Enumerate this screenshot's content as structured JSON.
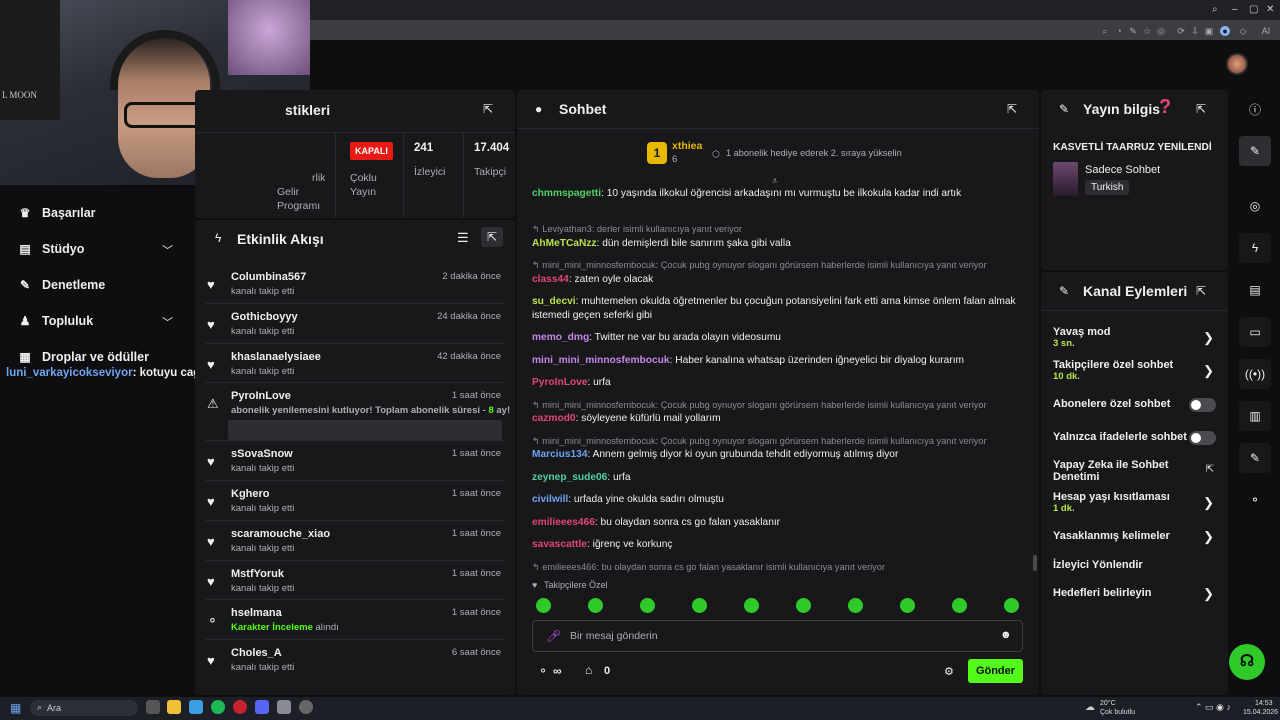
{
  "webcam": {
    "poster_text": "L MOON"
  },
  "left_nav": {
    "items": [
      {
        "label": "Başarılar",
        "icon": "trophy-icon"
      },
      {
        "label": "Stüdyo",
        "icon": "studio-icon"
      },
      {
        "label": "Denetleme",
        "icon": "wrench-icon"
      },
      {
        "label": "Topluluk",
        "icon": "community-icon"
      },
      {
        "label": "Droplar ve ödüller",
        "icon": "gift-icon"
      }
    ]
  },
  "overlay_message": {
    "user": "luni_varkayicokseviyor",
    "text": ": kotuyu cagirma"
  },
  "stats": {
    "title_partial": "stikleri",
    "live_badge": "KAPALI",
    "col0_a": "rlik",
    "col0_b": "Gelir",
    "col0_c": "Programı",
    "col1_a": "Çoklu",
    "col1_b": "Yayın",
    "viewers_value": "241",
    "viewers_label": "İzleyici",
    "followers_value": "17.404",
    "followers_label": "Takipçi"
  },
  "activity": {
    "title": "Etkinlik Akışı",
    "items": [
      {
        "name": "Columbina567",
        "sub": "kanalı takip etti",
        "time": "2 dakika önce"
      },
      {
        "name": "Gothicboyyy",
        "sub": "kanalı takip etti",
        "time": "24 dakika önce"
      },
      {
        "name": "khaslanaelysiaee",
        "sub": "kanalı takip etti",
        "time": "42 dakika önce"
      },
      {
        "name": "PyroInLove",
        "sub": "abonelik yenilemesini kutluyor! Toplam abonelik süresi - ",
        "sub_num": "8",
        "sub_end": " ay!",
        "time": "1 saat önce"
      },
      {
        "name": "sSovaSnow",
        "sub": "kanalı takip etti",
        "time": "1 saat önce"
      },
      {
        "name": "Kghero",
        "sub": "kanalı takip etti",
        "time": "1 saat önce"
      },
      {
        "name": "scaramouche_xiao",
        "sub": "kanalı takip etti",
        "time": "1 saat önce"
      },
      {
        "name": "MstfYoruk",
        "sub": "kanalı takip etti",
        "time": "1 saat önce"
      },
      {
        "name": "hselmana",
        "sub_green": "Karakter İnceleme",
        "sub": " alındı",
        "time": "1 saat önce"
      },
      {
        "name": "Choles_A",
        "sub": "kanalı takip etti",
        "time": "6 saat önce"
      }
    ]
  },
  "chat": {
    "title": "Sohbet",
    "pinned_user": "xthiea",
    "pinned_level": "1",
    "pinned_count": "6",
    "pinned_text": "1 abonelik hediye ederek 2. sıraya yükselin",
    "messages": [
      {
        "user": "chmmspagetti",
        "color": "#50d16a",
        "text": ": 10 yaşında ilkokul öğrencisi arkadaşını mı vurmuştu be ilkokula kadar indi artık"
      },
      {
        "reply": "Leviyathan3: derler isimli kullanıcıya yanıt veriyor",
        "user": "AhMeTCaNzz",
        "color": "#b8e34a",
        "text": ": dün demişlerdi bile sanırım şaka gibi valla"
      },
      {
        "reply": "mini_mini_minnosfembocuk: Çocuk pubg oynuyor sloganı görürsem haberlerde isimli kullanıcıya yanıt veriyor",
        "user": "class44",
        "color": "#e0457b",
        "text": ": zaten oyle olacak"
      },
      {
        "user": "su_decvi",
        "color": "#b8e34a",
        "text": ": muhtemelen okulda öğretmenler bu çocuğun potansiyelini fark etti ama kimse önlem falan almak istemedi geçen seferki gibi"
      },
      {
        "user": "memo_dmg",
        "color": "#c387e8",
        "text": ": Twitter ne var bu arada olayın videosumu"
      },
      {
        "user": "mini_mini_minnosfembocuk",
        "color": "#c387e8",
        "text": ": Haber kanalına whatsap üzerinden iğneyelici bir diyalog kurarım"
      },
      {
        "user": "PyroInLove",
        "color": "#e0457b",
        "text": ": urfa"
      },
      {
        "reply": "mini_mini_minnosfembocuk: Çocuk pubg oynuyor sloganı görürsem haberlerde isimli kullanıcıya yanıt veriyor",
        "user": "cazmod0",
        "color": "#e0457b",
        "text": ": söyleyene küfürlü mail yollarım"
      },
      {
        "reply": "mini_mini_minnosfembocuk: Çocuk pubg oynuyor sloganı görürsem haberlerde isimli kullanıcıya yanıt veriyor",
        "user": "Marcius134",
        "color": "#6ea4f0",
        "text": ": Annem gelmiş diyor ki oyun grubunda tehdit ediyormuş atılmış diyor"
      },
      {
        "user": "zeynep_sude06",
        "color": "#50d1a0",
        "text": ": urfa"
      },
      {
        "user": "civilwill",
        "color": "#6ea4f0",
        "text": ": urfada yine okulda sadırı olmuştu"
      },
      {
        "user": "emilieees466",
        "color": "#e0457b",
        "text": ": bu olaydan sonra cs go falan yasaklanır"
      },
      {
        "user": "savascattle",
        "color": "#e0457b",
        "text": ": iğrenç ve korkunç"
      },
      {
        "reply": "emilieees466: bu olaydan sonra cs go falan yasaklanır isimli kullanıcıya yanıt veriyor",
        "user": "luni_varkayicokseviyor",
        "color": "#6ea4f0",
        "text": ": kotuyu cagirma"
      }
    ],
    "followers_only": "Takipçilere Özel",
    "input_placeholder": "Bir mesaj gönderin",
    "points_value": "∞",
    "store_value": "0",
    "send_label": "Gönder"
  },
  "info": {
    "title": "Yayın bilgis",
    "stream_title": "KASVETLİ TAARRUZ YENİLENDİ",
    "category": "Sadece Sohbet",
    "tag": "Turkish"
  },
  "actions": {
    "title": "Kanal Eylemleri",
    "slow_mode": "Yavaş mod",
    "slow_mode_val": "3 sn.",
    "followers_chat": "Takipçilere özel sohbet",
    "followers_chat_val": "10 dk.",
    "subs_chat": "Abonelere özel sohbet",
    "emote_chat": "Yalnızca ifadelerle sohbet",
    "ai_chat": "Yapay Zeka ile Sohbet Denetimi",
    "age_limit": "Hesap yaşı kısıtlaması",
    "age_limit_val": "1 dk.",
    "banned_words": "Yasaklanmış kelimeler",
    "redirect": "İzleyici Yönlendir",
    "goals": "Hedefleri belirleyin"
  },
  "taskbar": {
    "search": "Ara",
    "weather_temp": "20°C",
    "weather_desc": "Çok bulutlu",
    "time": "14:53",
    "date": "15.04.2026"
  }
}
